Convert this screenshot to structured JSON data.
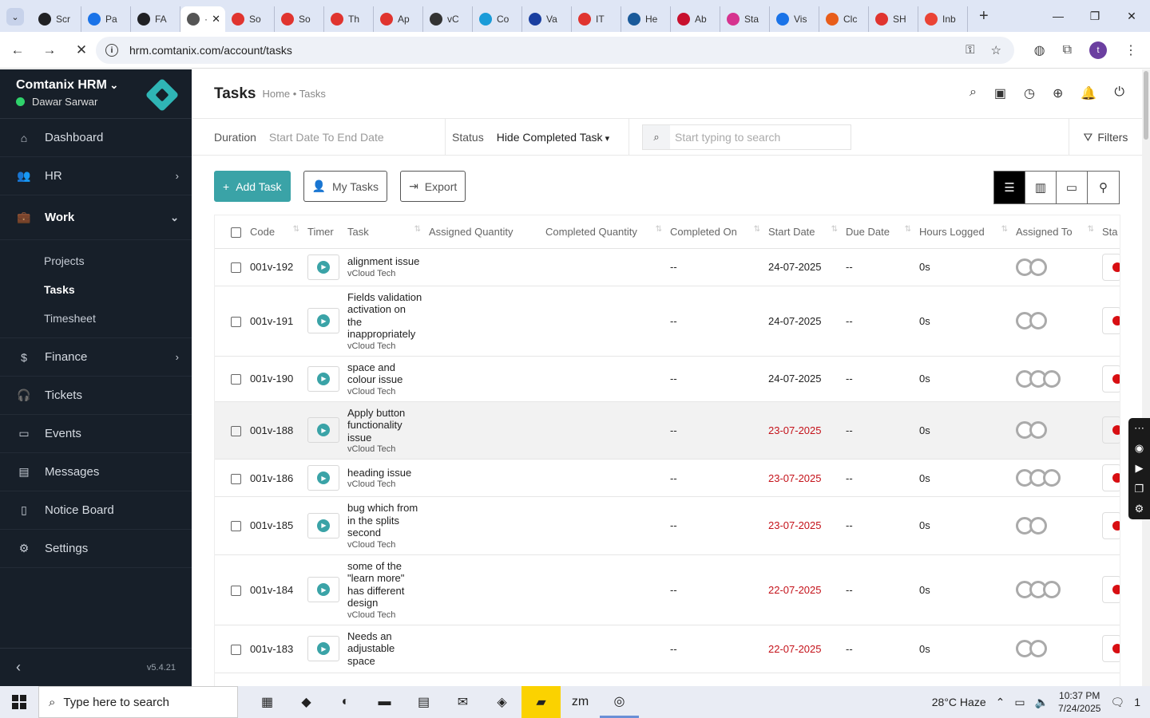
{
  "browser": {
    "tabs": [
      {
        "label": "Scr",
        "icon": "gear-icon",
        "color": "#202124"
      },
      {
        "label": "Pa",
        "icon": "wifi-icon",
        "color": "#1a73e8"
      },
      {
        "label": "FA",
        "icon": "openai-icon",
        "color": "#202124"
      },
      {
        "label": "·",
        "icon": "loading-icon",
        "color": "#555555",
        "active": true
      },
      {
        "label": "So",
        "icon": "tag-icon",
        "color": "#e0342f"
      },
      {
        "label": "So",
        "icon": "tag-icon",
        "color": "#e0342f"
      },
      {
        "label": "Th",
        "icon": "tag-icon",
        "color": "#e0342f"
      },
      {
        "label": "Ap",
        "icon": "tag-icon",
        "color": "#e0342f"
      },
      {
        "label": "vC",
        "icon": "v-icon",
        "color": "#333333"
      },
      {
        "label": "Co",
        "icon": "circle-icon",
        "color": "#1a9bd8"
      },
      {
        "label": "Va",
        "icon": "x-icon",
        "color": "#1a3fa0"
      },
      {
        "label": "IT",
        "icon": "tag-icon",
        "color": "#e0342f"
      },
      {
        "label": "He",
        "icon": "scale-icon",
        "color": "#1a5a9a"
      },
      {
        "label": "Ab",
        "icon": "brand-icon",
        "color": "#c8102e"
      },
      {
        "label": "Sta",
        "icon": "pen-icon",
        "color": "#d6338f"
      },
      {
        "label": "Vis",
        "icon": "pulse-icon",
        "color": "#1a73e8"
      },
      {
        "label": "Clc",
        "icon": "brush-icon",
        "color": "#e85d1a"
      },
      {
        "label": "SH",
        "icon": "ring-icon",
        "color": "#e0342f"
      },
      {
        "label": "Inb",
        "icon": "mail-icon",
        "color": "#ea4335"
      }
    ],
    "url": "hrm.comtanix.com/account/tasks",
    "profile_letter": "t"
  },
  "sidebar": {
    "company": "Comtanix HRM",
    "user": "Dawar Sarwar",
    "items": [
      {
        "label": "Dashboard",
        "icon": "home-icon"
      },
      {
        "label": "HR",
        "icon": "users-icon",
        "chevron": "right"
      },
      {
        "label": "Work",
        "icon": "briefcase-icon",
        "chevron": "down"
      },
      {
        "label": "Finance",
        "icon": "dollar-icon",
        "chevron": "right"
      },
      {
        "label": "Tickets",
        "icon": "headset-icon"
      },
      {
        "label": "Events",
        "icon": "calendar-icon"
      },
      {
        "label": "Messages",
        "icon": "message-icon"
      },
      {
        "label": "Notice Board",
        "icon": "clipboard-icon"
      },
      {
        "label": "Settings",
        "icon": "settings-icon"
      }
    ],
    "work_sub": [
      "Projects",
      "Tasks",
      "Timesheet"
    ],
    "version": "v5.4.21"
  },
  "header": {
    "title": "Tasks",
    "breadcrumb": "Home • Tasks"
  },
  "filters": {
    "duration_label": "Duration",
    "duration_placeholder": "Start Date To End Date",
    "status_label": "Status",
    "status_value": "Hide Completed Task",
    "search_placeholder": "Start typing to search",
    "filters_label": "Filters"
  },
  "actions": {
    "add": "Add Task",
    "my_tasks": "My Tasks",
    "export": "Export"
  },
  "table": {
    "columns": [
      "Code",
      "Timer",
      "Task",
      "Assigned Quantity",
      "Completed Quantity",
      "Completed On",
      "Start Date",
      "Due Date",
      "Hours Logged",
      "Assigned To",
      "Sta"
    ],
    "rows": [
      {
        "code": "001v-192",
        "task": "alignment issue",
        "project": "vCloud Tech",
        "completed_on": "--",
        "start": "24-07-2025",
        "due": "--",
        "hours": "0s",
        "overdue": false,
        "avatars": 2
      },
      {
        "code": "001v-191",
        "task": "Fields validation activation on the inappropriately",
        "project": "vCloud Tech",
        "completed_on": "--",
        "start": "24-07-2025",
        "due": "--",
        "hours": "0s",
        "overdue": false,
        "avatars": 2
      },
      {
        "code": "001v-190",
        "task": "space and colour issue",
        "project": "vCloud Tech",
        "completed_on": "--",
        "start": "24-07-2025",
        "due": "--",
        "hours": "0s",
        "overdue": false,
        "avatars": 3
      },
      {
        "code": "001v-188",
        "task": "Apply button functionality issue",
        "project": "vCloud Tech",
        "completed_on": "--",
        "start": "23-07-2025",
        "due": "--",
        "hours": "0s",
        "overdue": true,
        "avatars": 2,
        "highlight": true
      },
      {
        "code": "001v-186",
        "task": "heading issue",
        "project": "vCloud Tech",
        "completed_on": "--",
        "start": "23-07-2025",
        "due": "--",
        "hours": "0s",
        "overdue": true,
        "avatars": 3
      },
      {
        "code": "001v-185",
        "task": "bug which from in the splits second",
        "project": "vCloud Tech",
        "completed_on": "--",
        "start": "23-07-2025",
        "due": "--",
        "hours": "0s",
        "overdue": true,
        "avatars": 2
      },
      {
        "code": "001v-184",
        "task": "some of the \"learn more\" has different design",
        "project": "vCloud Tech",
        "completed_on": "--",
        "start": "22-07-2025",
        "due": "--",
        "hours": "0s",
        "overdue": true,
        "avatars": 3
      },
      {
        "code": "001v-183",
        "task": "Needs an adjustable space",
        "project": "",
        "completed_on": "--",
        "start": "22-07-2025",
        "due": "--",
        "hours": "0s",
        "overdue": true,
        "avatars": 2
      }
    ]
  },
  "taskbar": {
    "search_placeholder": "Type here to search",
    "weather": "28°C  Haze",
    "time": "10:37 PM",
    "date": "7/24/2025",
    "notifications": "1"
  },
  "colors": {
    "accent": "#3aa3a7",
    "sidebar_bg": "#171f29",
    "overdue": "#c4121a",
    "status_dot": "#d80e12"
  }
}
